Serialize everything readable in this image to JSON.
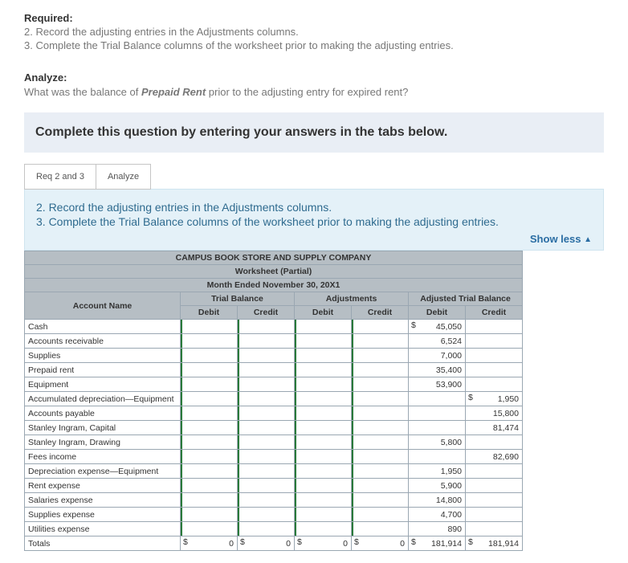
{
  "required": {
    "heading": "Required:",
    "items": [
      "2. Record the adjusting entries in the Adjustments columns.",
      "3. Complete the Trial Balance columns of the worksheet prior to making the adjusting entries."
    ]
  },
  "analyze": {
    "heading": "Analyze:",
    "prefix": "What was the balance of ",
    "emph": "Prepaid Rent",
    "suffix": " prior to the adjusting entry for expired rent?"
  },
  "banner": "Complete this question by entering your answers in the tabs below.",
  "tabs": {
    "t1": "Req 2 and 3",
    "t2": "Analyze"
  },
  "panel": {
    "l1": "2. Record the adjusting entries in the Adjustments columns.",
    "l2": "3. Complete the Trial Balance columns of the worksheet prior to making the adjusting entries.",
    "showless": "Show less"
  },
  "ws": {
    "company": "CAMPUS BOOK STORE AND SUPPLY COMPANY",
    "title": "Worksheet (Partial)",
    "period": "Month Ended November 30, 20X1",
    "grp": {
      "tb": "Trial Balance",
      "adj": "Adjustments",
      "atb": "Adjusted Trial Balance"
    },
    "col": {
      "acct": "Account Name",
      "dr": "Debit",
      "cr": "Credit"
    },
    "rows": [
      {
        "name": "Cash",
        "atb_dr": "45,050",
        "atb_dr_cur": "$"
      },
      {
        "name": "Accounts receivable",
        "atb_dr": "6,524"
      },
      {
        "name": "Supplies",
        "atb_dr": "7,000"
      },
      {
        "name": "Prepaid rent",
        "atb_dr": "35,400"
      },
      {
        "name": "Equipment",
        "atb_dr": "53,900"
      },
      {
        "name": "Accumulated depreciation—Equipment",
        "atb_cr": "1,950",
        "atb_cr_cur": "$"
      },
      {
        "name": "Accounts payable",
        "atb_cr": "15,800"
      },
      {
        "name": "Stanley Ingram, Capital",
        "atb_cr": "81,474"
      },
      {
        "name": "Stanley Ingram, Drawing",
        "atb_dr": "5,800"
      },
      {
        "name": "Fees income",
        "atb_cr": "82,690"
      },
      {
        "name": "Depreciation expense—Equipment",
        "atb_dr": "1,950"
      },
      {
        "name": "Rent expense",
        "atb_dr": "5,900"
      },
      {
        "name": "Salaries expense",
        "atb_dr": "14,800"
      },
      {
        "name": "Supplies expense",
        "atb_dr": "4,700"
      },
      {
        "name": "Utilities expense",
        "atb_dr": "890"
      }
    ],
    "totals": {
      "name": "Totals",
      "tb_dr": "0",
      "tb_dr_cur": "$",
      "tb_cr": "0",
      "tb_cr_cur": "$",
      "adj_dr": "0",
      "adj_dr_cur": "$",
      "adj_cr": "0",
      "adj_cr_cur": "$",
      "atb_dr": "181,914",
      "atb_dr_cur": "$",
      "atb_cr": "181,914",
      "atb_cr_cur": "$"
    }
  }
}
